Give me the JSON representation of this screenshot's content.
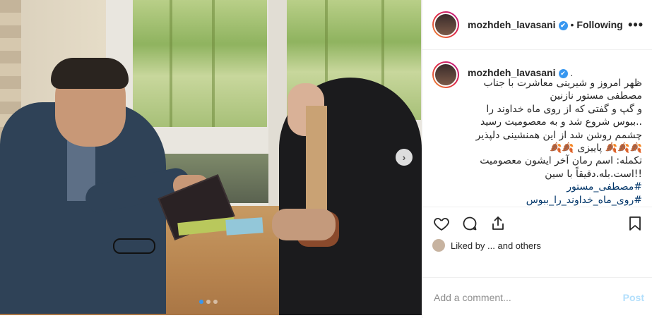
{
  "post": {
    "username": "mozhdeh_lavasani",
    "verified_mark": "✔",
    "separator": "•",
    "follow_label": "Following",
    "more_label": "•••",
    "caption_dot": ".",
    "caption_lines": [
      "ظهر امروز و شیرینی معاشرت با جناب",
      "مصطفی مستور نازنین",
      "و گپ و گفتی که از روی ماه خداوند را",
      "..ببوس شروع شد و به معصومیت رسید",
      "چشمم روشن شد از این همنشینی دلپذیر",
      "پاییزی",
      "تکمله: اسم رمان آخر ایشون معصومیت",
      "!!است.بله.دقیقاً با سین"
    ],
    "autumn_emoji": "🍂🍂🍂",
    "autumn_emoji_2": "🍂🍂",
    "hashtags": [
      "#مصطفی_مستور",
      "#روی_ماه_خداوند_را_ببوس"
    ],
    "likes_text": "Liked by ... and others",
    "add_comment_placeholder": "Add a comment...",
    "post_label": "Post"
  },
  "media": {
    "next_icon": "›",
    "slide_count": 3,
    "active_slide": 1
  },
  "icons": {
    "like": "heart-icon",
    "comment": "comment-icon",
    "share": "share-icon",
    "save": "bookmark-icon"
  },
  "colors": {
    "verified": "#3897f0",
    "hashtag": "#003569",
    "post_button": "#b2dffc"
  }
}
